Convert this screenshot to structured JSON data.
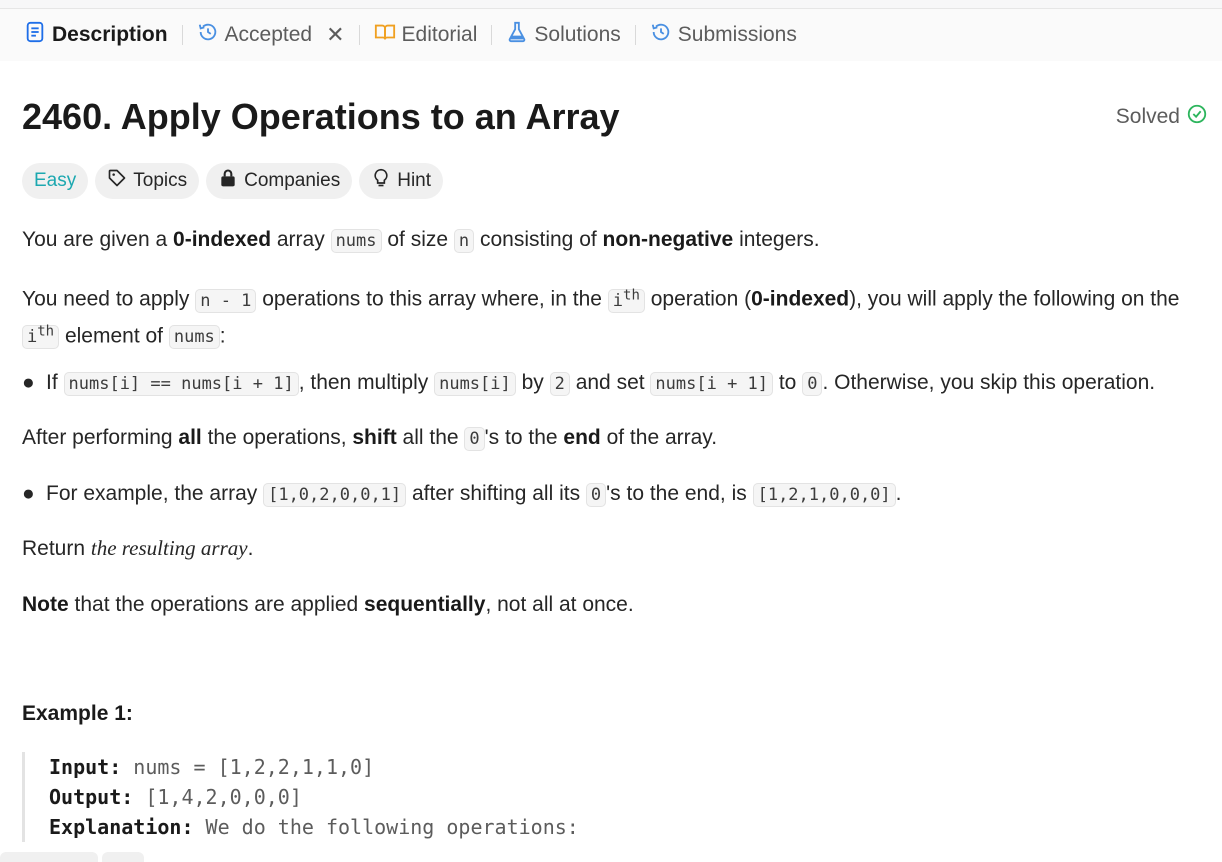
{
  "tabs": {
    "description": "Description",
    "accepted": "Accepted",
    "editorial": "Editorial",
    "solutions": "Solutions",
    "submissions": "Submissions"
  },
  "problem": {
    "title": "2460. Apply Operations to an Array",
    "status": "Solved"
  },
  "tags": {
    "difficulty": "Easy",
    "topics": "Topics",
    "companies": "Companies",
    "hint": "Hint"
  },
  "description": {
    "p1": {
      "a": "You are given a ",
      "b": "0-indexed",
      "c": " array ",
      "code1": "nums",
      "d": " of size ",
      "code2": "n",
      "e": " consisting of ",
      "f": "non-negative",
      "g": " integers."
    },
    "p2": {
      "a": "You need to apply ",
      "code1": "n - 1",
      "b": " operations to this array where, in the ",
      "code2": "i",
      "sup": "th",
      "c": " operation (",
      "d": "0-indexed",
      "e": "), you will apply the following on the ",
      "code3": "i",
      "sup2": "th",
      "f": " element of ",
      "code4": "nums",
      "g": ":"
    },
    "bullet1": {
      "a": "If ",
      "code1": "nums[i] == nums[i + 1]",
      "b": ", then multiply ",
      "code2": "nums[i]",
      "c": " by ",
      "code3": "2",
      "d": " and set ",
      "code4": "nums[i + 1]",
      "e": " to ",
      "code5": "0",
      "f": ". Otherwise, you skip this operation."
    },
    "p3": {
      "a": "After performing ",
      "b": "all",
      "c": " the operations, ",
      "d": "shift",
      "e": " all the ",
      "code1": "0",
      "f": "'s to the ",
      "g": "end",
      "h": " of the array."
    },
    "bullet2": {
      "a": "For example, the array ",
      "code1": "[1,0,2,0,0,1]",
      "b": " after shifting all its ",
      "code2": "0",
      "c": "'s to the end, is ",
      "code3": "[1,2,1,0,0,0]",
      "d": "."
    },
    "p4": {
      "a": "Return ",
      "em": "the resulting array",
      "b": "."
    },
    "p5": {
      "a": "Note",
      "b": " that the operations are applied ",
      "c": "sequentially",
      "d": ", not all at once."
    }
  },
  "example1": {
    "title": "Example 1:",
    "input_label": "Input:",
    "input_value": " nums = [1,2,2,1,1,0]",
    "output_label": "Output:",
    "output_value": " [1,4,2,0,0,0]",
    "explanation_label": "Explanation:",
    "explanation_value": " We do the following operations:"
  }
}
